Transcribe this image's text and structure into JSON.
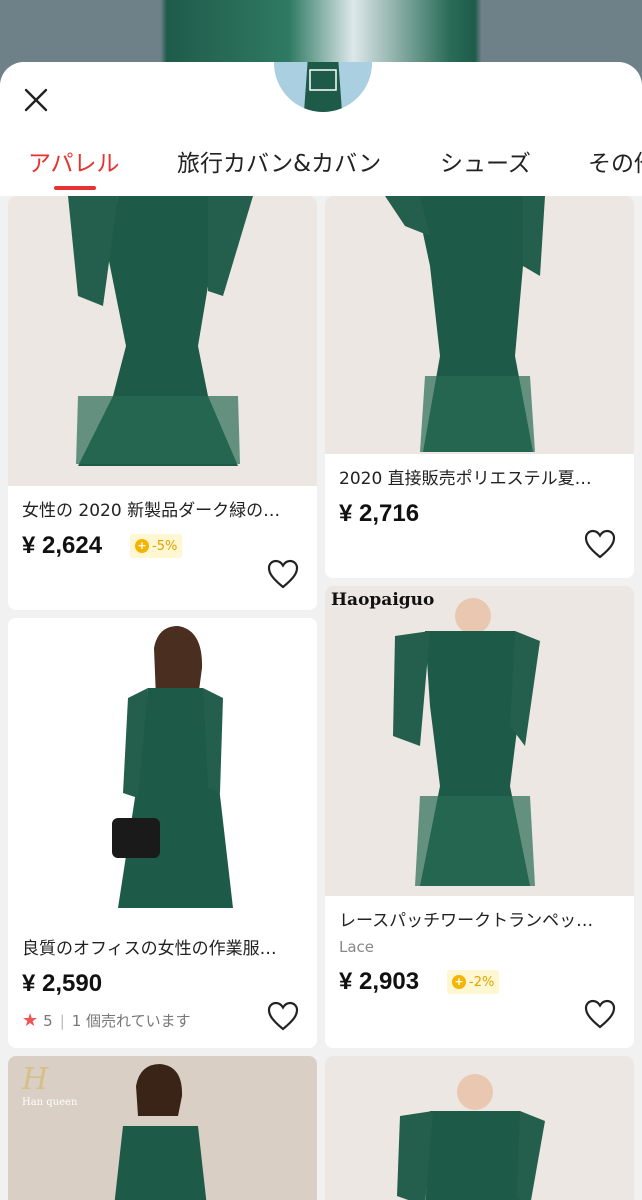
{
  "tabs": [
    {
      "label": "アパレル",
      "active": true
    },
    {
      "label": "旅行カバン&カバン",
      "active": false
    },
    {
      "label": "シューズ",
      "active": false
    },
    {
      "label": "その他"
    }
  ],
  "products": [
    {
      "title": "女性の 2020 新製品ダーク緑の…",
      "price": "¥ 2,624",
      "badge": "-5%"
    },
    {
      "title": "2020 直接販売ポリエステル夏…",
      "price": "¥ 2,716"
    },
    {
      "title": "良質のオフィスの女性の作業服…",
      "price": "¥ 2,590",
      "rating": "5",
      "sold": "1 個売れています"
    },
    {
      "title": "レースパッチワークトランペッ…",
      "subtitle": "Lace",
      "price": "¥ 2,903",
      "badge": "-2%",
      "watermark": "Haopaiguo"
    },
    {
      "logo_mark": "H",
      "logo_text": "Han queen"
    },
    {}
  ],
  "colors": {
    "accent": "#e8322f",
    "dress": "#1d5a48",
    "badge_bg": "#fff6d2",
    "badge_text": "#e0a400"
  }
}
